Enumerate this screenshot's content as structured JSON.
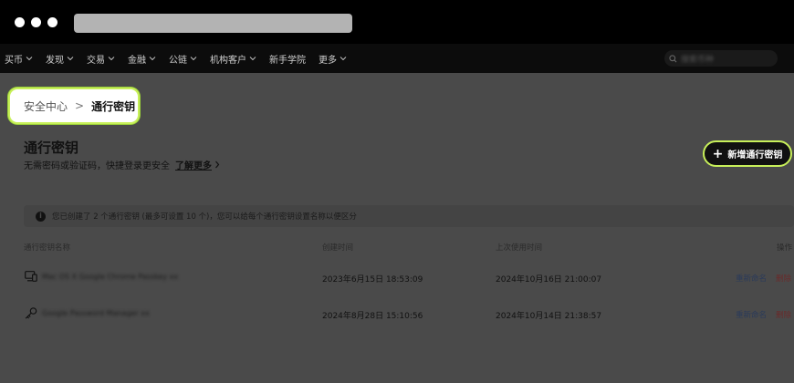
{
  "nav": {
    "items": [
      {
        "label": "买币",
        "has_dropdown": true
      },
      {
        "label": "发现",
        "has_dropdown": true
      },
      {
        "label": "交易",
        "has_dropdown": true
      },
      {
        "label": "金融",
        "has_dropdown": true
      },
      {
        "label": "公链",
        "has_dropdown": true
      },
      {
        "label": "机构客户",
        "has_dropdown": true
      },
      {
        "label": "新手学院",
        "has_dropdown": false
      },
      {
        "label": "更多",
        "has_dropdown": true
      }
    ],
    "search_placeholder": "搜索币种"
  },
  "breadcrumb": {
    "parent": "安全中心",
    "separator": ">",
    "current": "通行密钥"
  },
  "page": {
    "title": "通行密钥",
    "subtitle": "无需密码或验证码，快捷登录更安全",
    "learn_more": "了解更多",
    "add_button": "新增通行密钥"
  },
  "notice": {
    "icon": "info-icon",
    "text": "您已创建了 2 个通行密钥 (最多可设置 10 个)，您可以给每个通行密钥设置名称以便区分"
  },
  "table": {
    "columns": [
      "通行密钥名称",
      "创建时间",
      "上次使用时间",
      "操作"
    ],
    "rows": [
      {
        "icon": "device-icon",
        "name": "Mac OS X Google Chrome Passkey xx",
        "created": "2023年6月15日 18:53:09",
        "last_used": "2024年10月16日 21:00:07",
        "rename": "重新命名",
        "delete": "删除"
      },
      {
        "icon": "key-icon",
        "name": "Google Password Manager xx",
        "created": "2024年8月28日 15:10:56",
        "last_used": "2024年10月14日 21:38:57",
        "rename": "重新命名",
        "delete": "删除"
      }
    ]
  },
  "colors": {
    "accent": "#c8f05a",
    "overlay": "#4a4a4a"
  }
}
